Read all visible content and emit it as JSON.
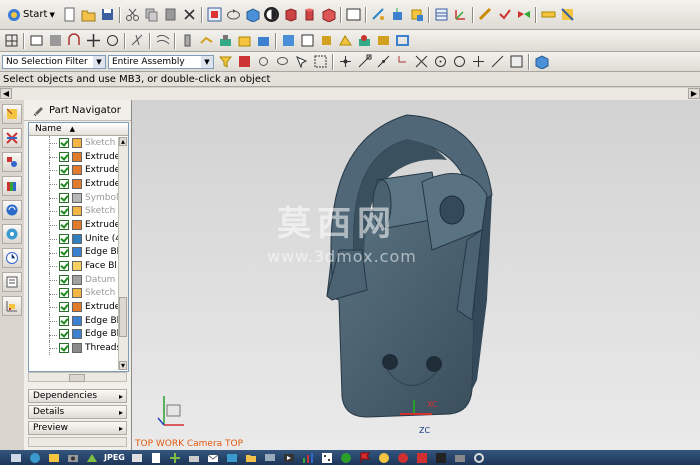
{
  "toolbar": {
    "start_label": "Start",
    "selection_filter": "No Selection Filter",
    "scope": "Entire Assembly"
  },
  "cue_line": "Select objects and use MB3, or double-click an object",
  "part_navigator": {
    "title": "Part Navigator",
    "column_name": "Name",
    "items": [
      {
        "label": "Sketch",
        "icon": "sketch-icon",
        "grey": true
      },
      {
        "label": "Extrude",
        "icon": "extrude-icon",
        "grey": false
      },
      {
        "label": "Extrude",
        "icon": "extrude-icon",
        "grey": false
      },
      {
        "label": "Extrude",
        "icon": "extrude-icon",
        "grey": false
      },
      {
        "label": "Symbol",
        "icon": "symbol-icon",
        "grey": true
      },
      {
        "label": "Sketch",
        "icon": "sketch-icon",
        "grey": true
      },
      {
        "label": "Extrude",
        "icon": "extrude-icon",
        "grey": false
      },
      {
        "label": "Unite (4",
        "icon": "unite-icon",
        "grey": false
      },
      {
        "label": "Edge Bl",
        "icon": "edge-blend-icon",
        "grey": false
      },
      {
        "label": "Face Bl",
        "icon": "face-blend-icon",
        "grey": false
      },
      {
        "label": "Datum",
        "icon": "datum-icon",
        "grey": true
      },
      {
        "label": "Sketch",
        "icon": "sketch-icon",
        "grey": true
      },
      {
        "label": "Extrude",
        "icon": "extrude-icon",
        "grey": false
      },
      {
        "label": "Edge Bl",
        "icon": "edge-blend-icon",
        "grey": false
      },
      {
        "label": "Edge Bl",
        "icon": "edge-blend-icon",
        "grey": false
      },
      {
        "label": "Threads",
        "icon": "thread-icon",
        "grey": false
      }
    ],
    "panels": [
      "Dependencies",
      "Details",
      "Preview"
    ]
  },
  "viewport": {
    "view_label": "TOP WORK Camera TOP",
    "watermark_cn": "莫西网",
    "watermark_url": "www.3dmox.com",
    "axis_xc": "XC",
    "axis_zc": "ZC"
  },
  "status_bar": {
    "jpeg_label": "JPEG"
  },
  "colors": {
    "part": "#4a6170",
    "part_dark": "#2f4250",
    "view_label": "#e05a10",
    "taskbar": "#23426a"
  }
}
